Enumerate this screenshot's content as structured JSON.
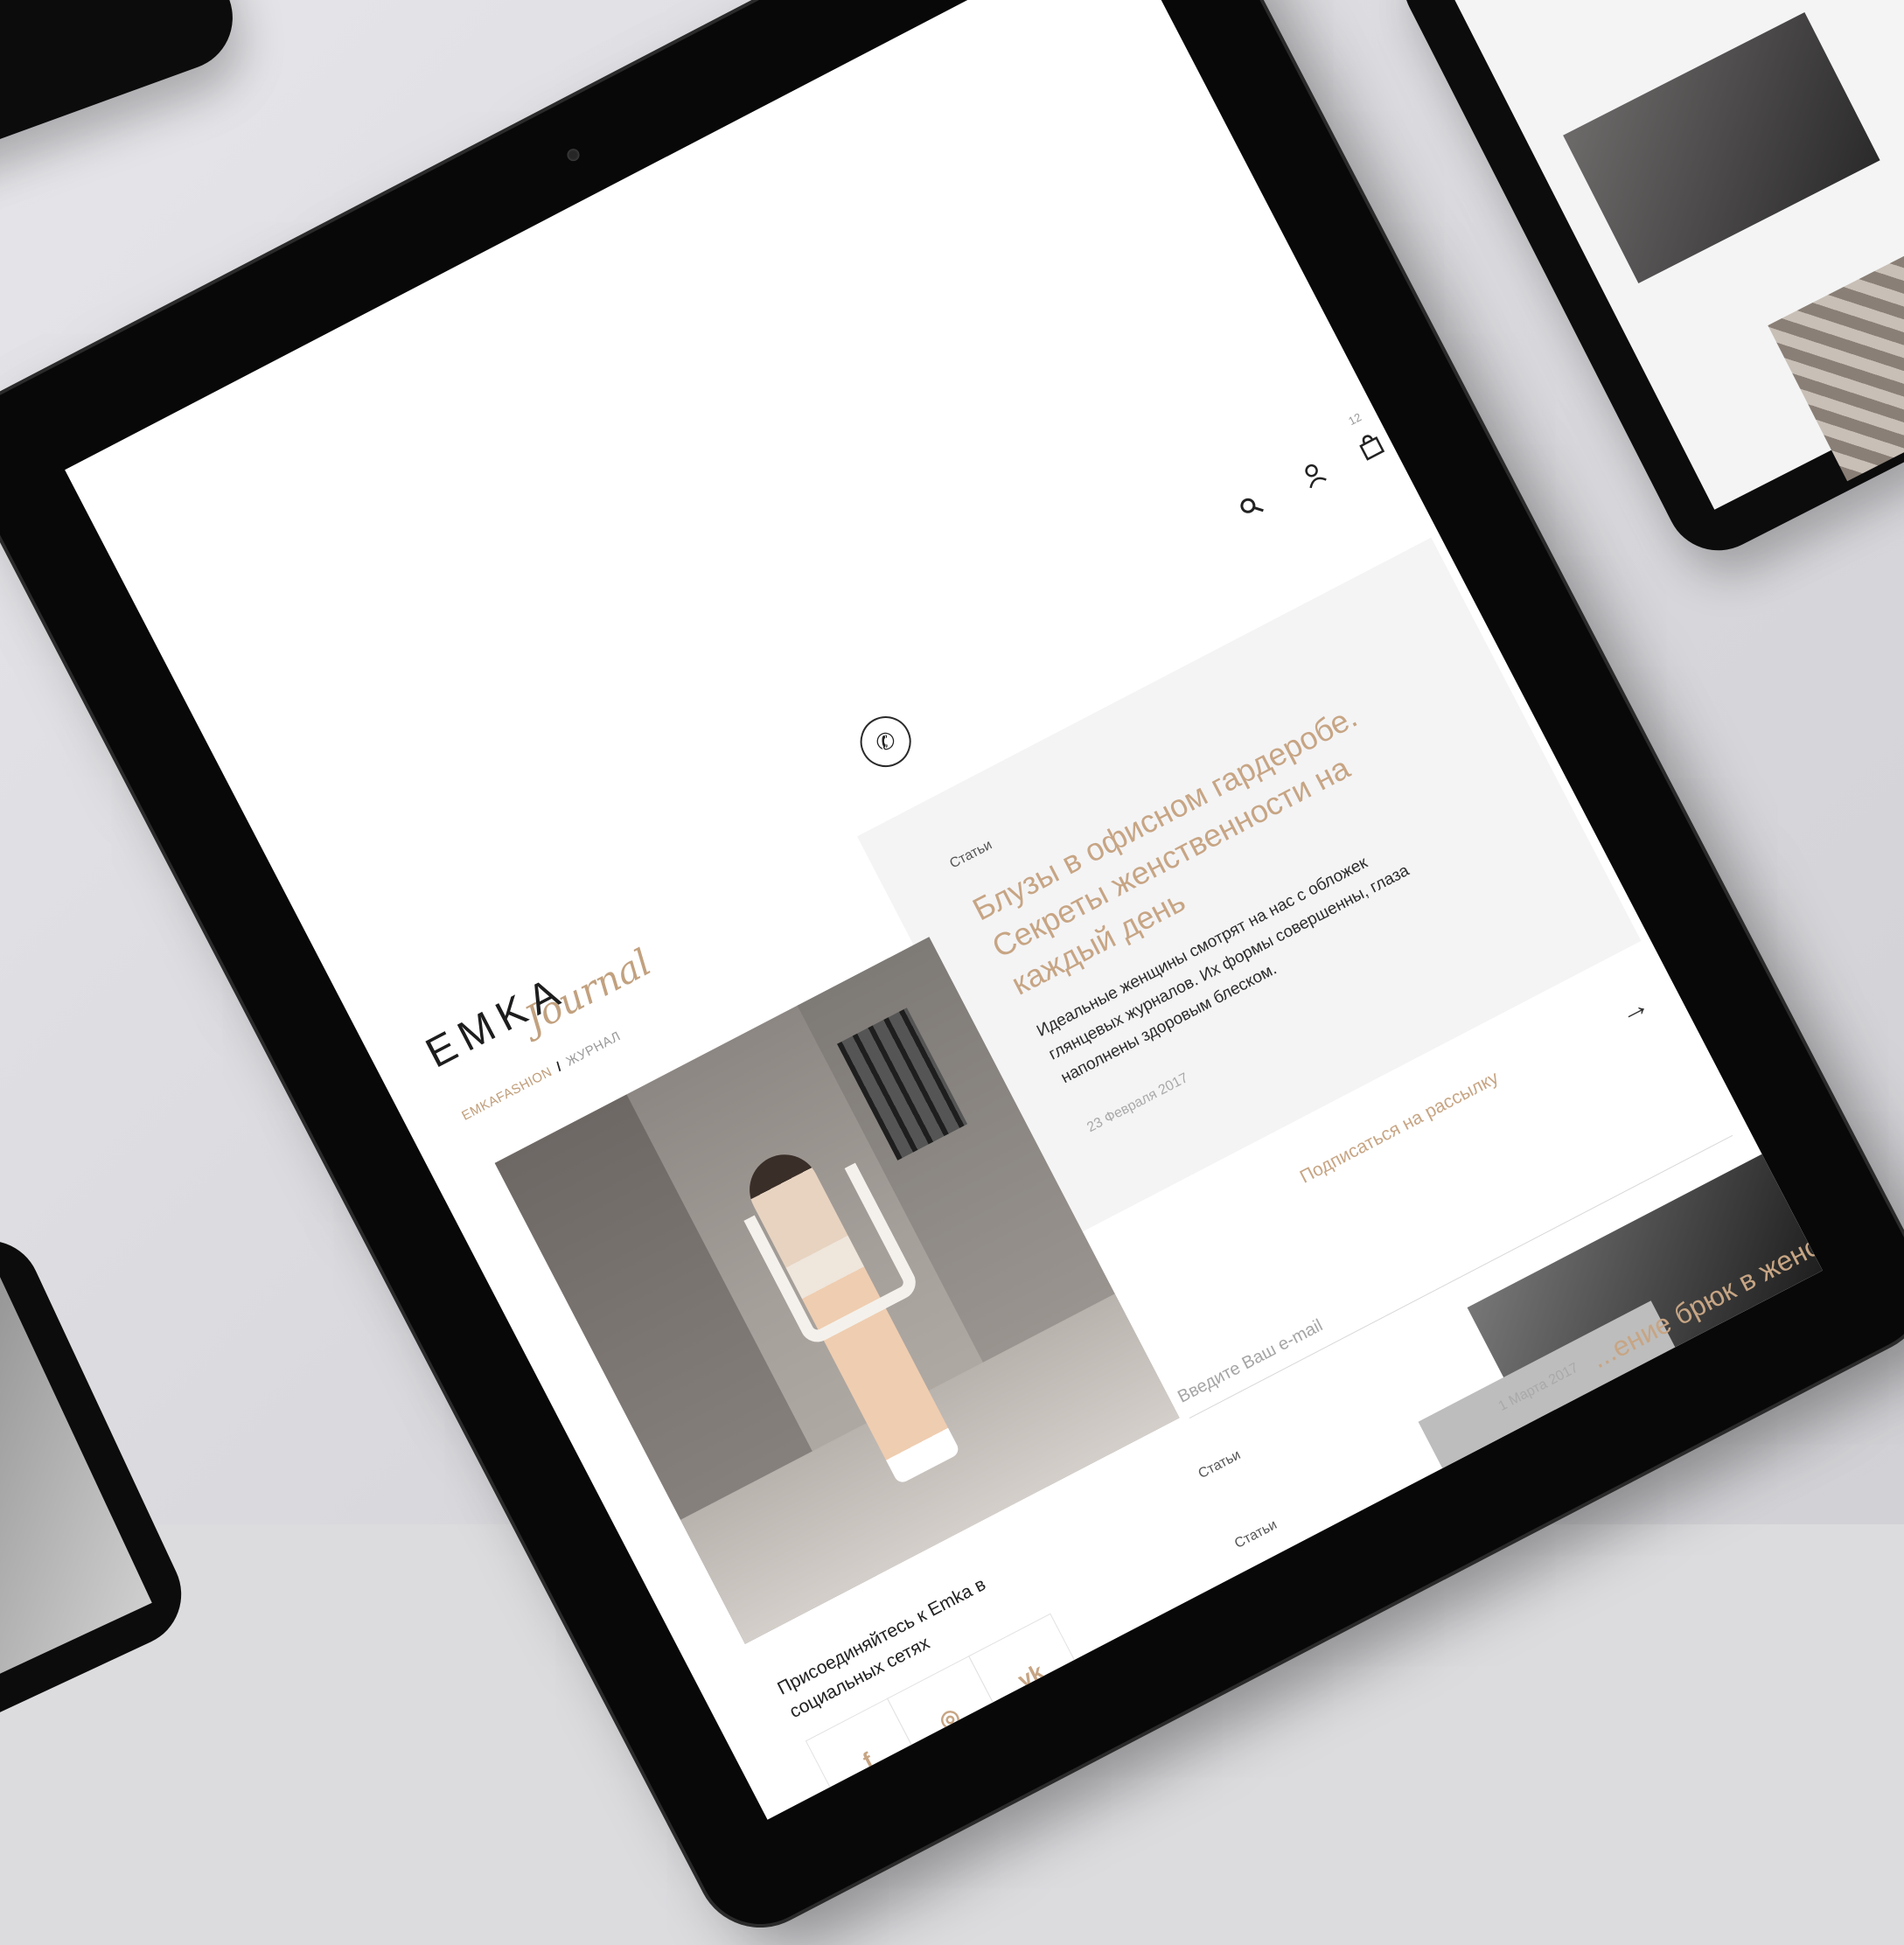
{
  "brand": {
    "logo_text": "EMKA",
    "logo_script": "Journal"
  },
  "breadcrumb": {
    "home": "EMKAFASHION",
    "current": "ЖУРНАЛ"
  },
  "header": {
    "cart_count": "12"
  },
  "featured": {
    "category": "Статьи",
    "title": "Блузы в офисном гардеробе. Секреты женственности на каждый день",
    "excerpt": "Идеальные женщины смотрят на нас с обложек глянцевых журналов. Их формы совершенны, глаза наполнены здоровым блеском.",
    "date": "23 Февраля 2017"
  },
  "subscribe": {
    "link_label": "Подписаться на рассылку",
    "email_placeholder": "Введите Ваш e-mail"
  },
  "social": {
    "title": "Присоединяйтесь к Emka в социальных сетях",
    "networks": [
      "f",
      "◎",
      "vk"
    ]
  },
  "articles": [
    {
      "category": "Статьи",
      "date": "1 Марта 2017",
      "title_partial": "...ение брюк в женском"
    },
    {
      "category": "Статьи"
    }
  ],
  "colors": {
    "accent": "#c7a584",
    "bezel": "#080808",
    "desk": "#dcdcdf"
  }
}
